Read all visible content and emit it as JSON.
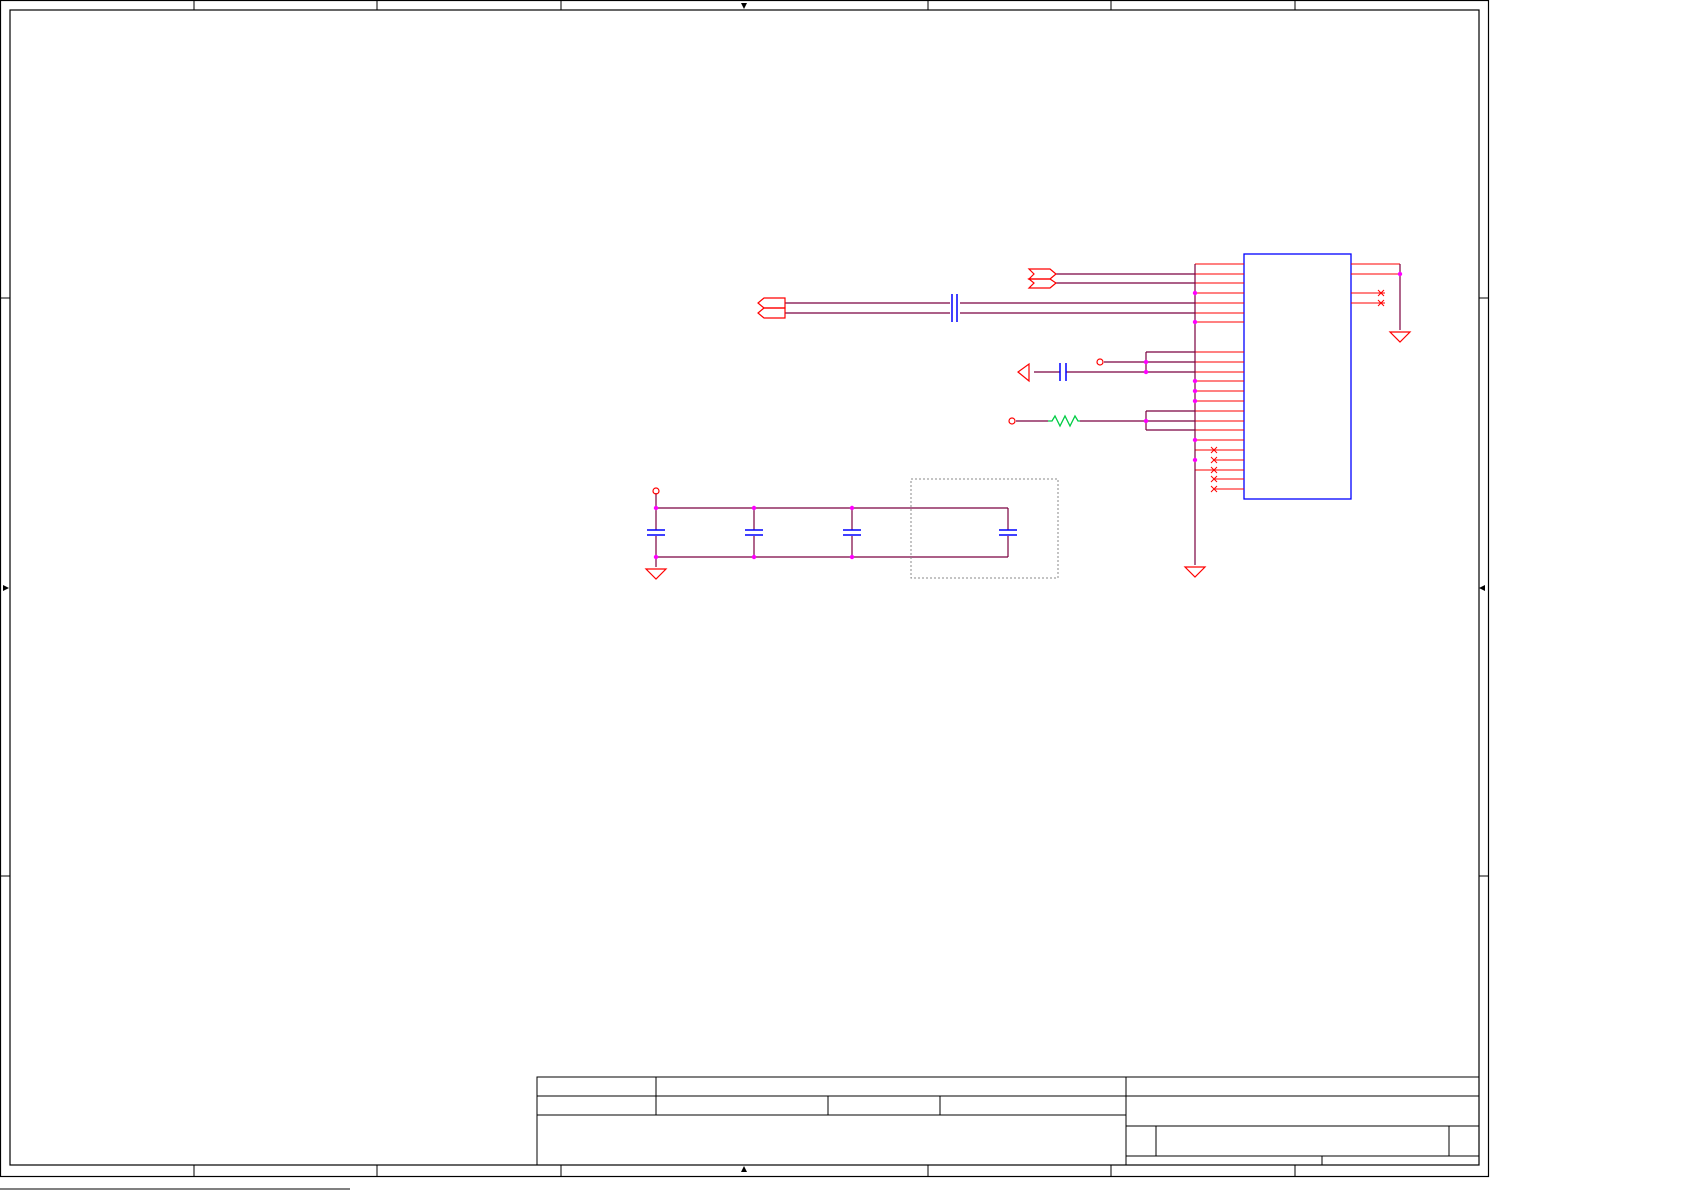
{
  "sheet": {
    "footer_text": "",
    "colors": {
      "border": "#000000",
      "wire": "#7a0040",
      "pin": "#ff0000",
      "junction": "#ff00ff",
      "part": "#0000ff",
      "resistor": "#00cc44",
      "ground": "#ff0000",
      "dotted_box": "#888888"
    }
  },
  "title_block": {
    "title_label": "",
    "size_label": "",
    "document_label": "",
    "rev_label": "",
    "date_label": "",
    "sheet_label": ""
  },
  "components": {
    "ic": {
      "name": "",
      "value": ""
    },
    "capacitors": [],
    "resistors": [],
    "connectors": []
  }
}
